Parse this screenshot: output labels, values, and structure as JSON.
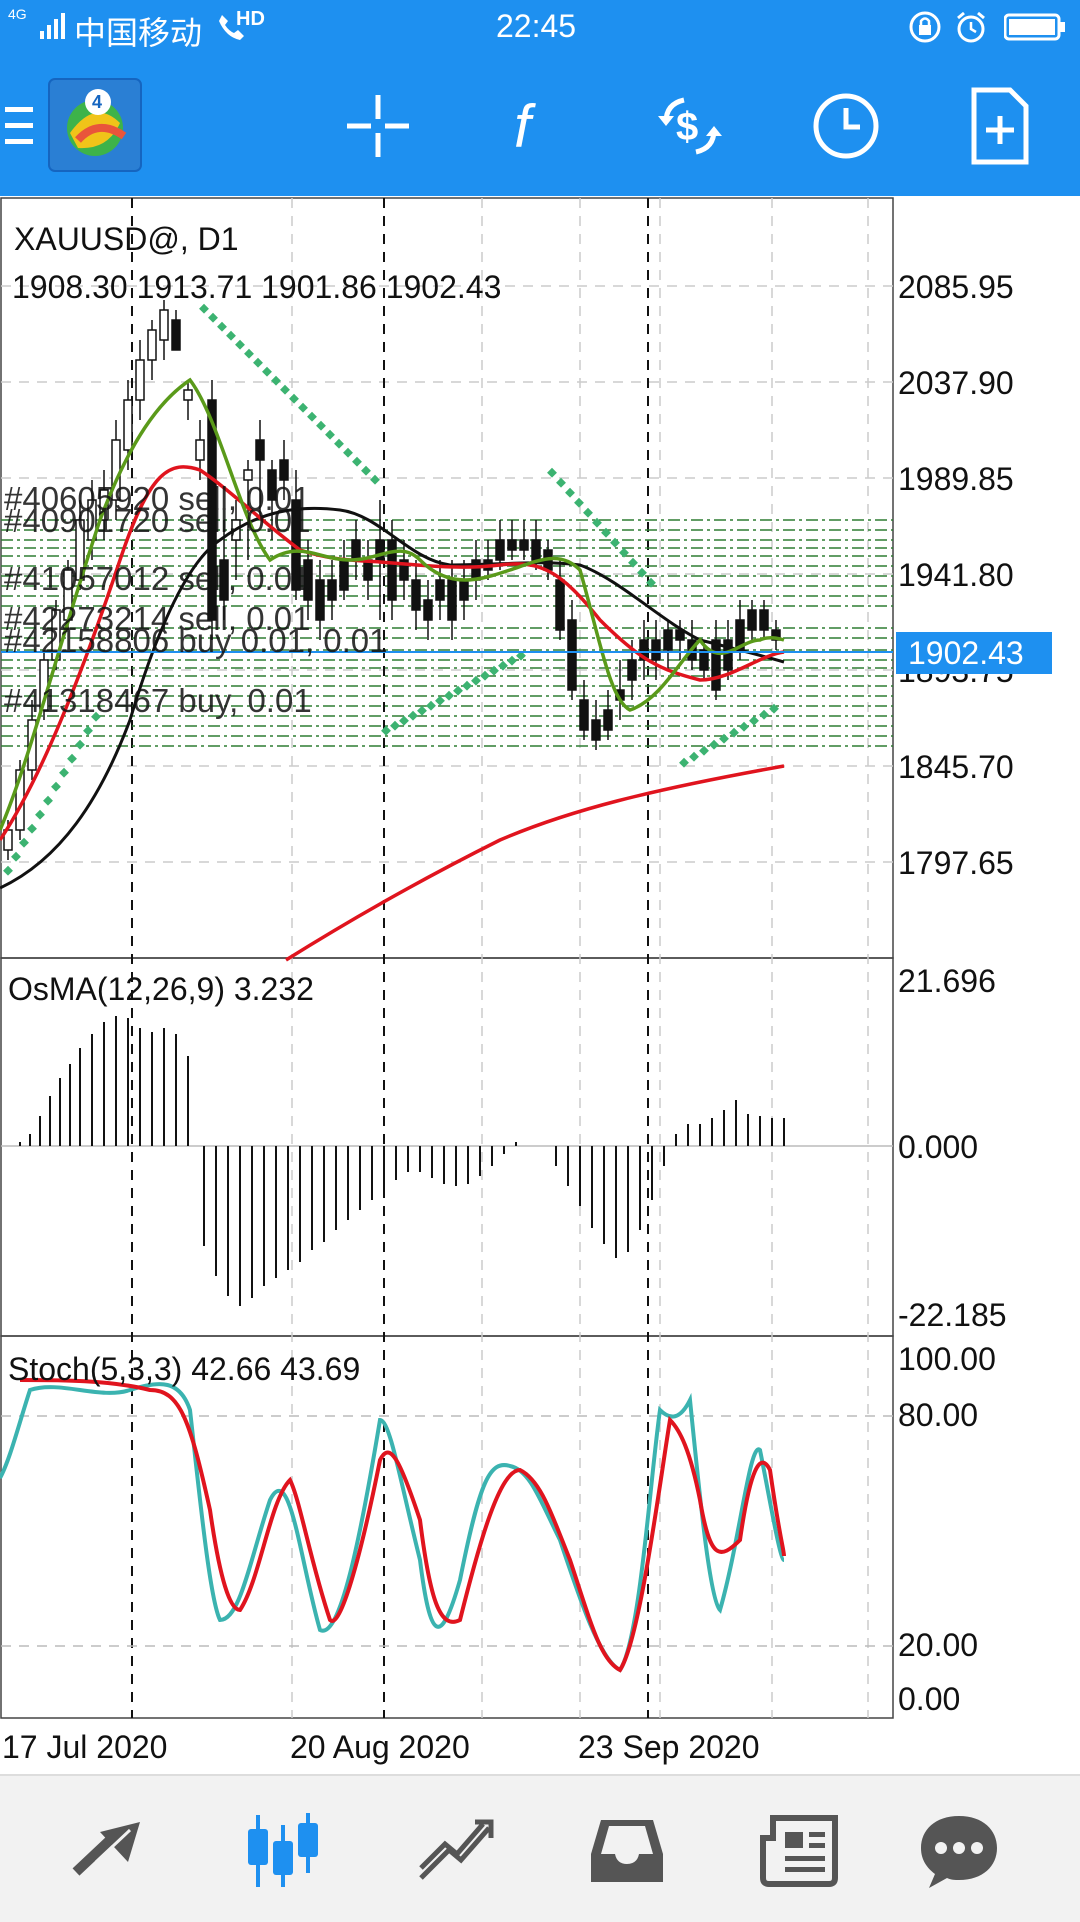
{
  "status_bar": {
    "carrier": "中国移动",
    "network": "4G",
    "hd": "HD",
    "time": "22:45"
  },
  "toolbar": {
    "icons": [
      "menu-icon",
      "mt4-logo",
      "crosshair-icon",
      "function-icon",
      "trade-icon",
      "clock-icon",
      "new-order-icon"
    ]
  },
  "chart": {
    "symbol": "XAUUSD@, D1",
    "ohlc": "1908.30 1913.71 1901.86 1902.43",
    "price_axis": [
      "2085.95",
      "2037.90",
      "1989.85",
      "1941.80",
      "1893.75",
      "1845.70",
      "1797.65"
    ],
    "current_price": "1902.43",
    "order_labels": [
      "#40605920 sell, 0.01",
      "#40901720 sell, 0.01",
      "#41057012 sell, 0.01",
      "#42273214 sell, 0.01",
      "#42158806 buy 0.01, 0.01",
      "#41318467 buy, 0.01"
    ],
    "osma_label": "OsMA(12,26,9) 3.232",
    "osma_axis": [
      "21.696",
      "0.000",
      "-22.185"
    ],
    "stoch_label": "Stoch(5,3,3) 42.66 43.69",
    "stoch_axis": [
      "100.00",
      "80.00",
      "20.00",
      "0.00"
    ],
    "time_axis": [
      "17 Jul 2020",
      "20 Aug 2020",
      "23 Sep 2020"
    ],
    "colors": {
      "ma_red": "#E0141E",
      "ma_green": "#5A9A1A",
      "ma_black": "#111111",
      "sar_green": "#3CB371",
      "stoch_main": "#3BB3B0",
      "stoch_signal": "#E0141E",
      "current_price_bg": "#1E90F0",
      "order_line": "#2E7D32"
    }
  },
  "bottom_nav": {
    "items": [
      "quotes-icon",
      "chart-icon",
      "trade-icon",
      "history-icon",
      "news-icon",
      "chat-icon"
    ],
    "active": "chart-icon"
  }
}
